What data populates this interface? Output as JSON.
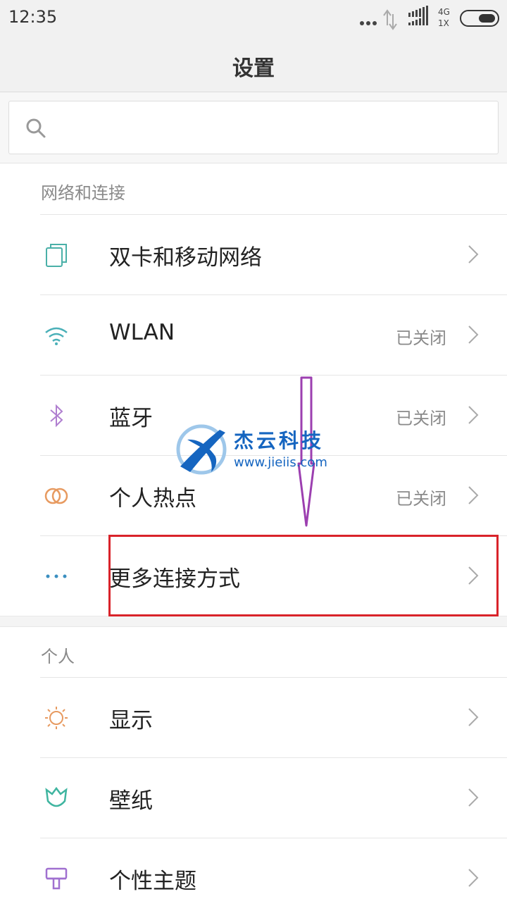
{
  "status_bar": {
    "time": "12:35",
    "net_top": "4G",
    "net_bottom": "1X"
  },
  "header": {
    "title": "设置"
  },
  "search": {
    "placeholder": ""
  },
  "sections": [
    {
      "title": "网络和连接",
      "items": [
        {
          "label": "双卡和移动网络",
          "status": "",
          "icon": "sim-cards-icon"
        },
        {
          "label": "WLAN",
          "status": "已关闭",
          "icon": "wifi-icon"
        },
        {
          "label": "蓝牙",
          "status": "已关闭",
          "icon": "bluetooth-icon"
        },
        {
          "label": "个人热点",
          "status": "已关闭",
          "icon": "hotspot-icon"
        },
        {
          "label": "更多连接方式",
          "status": "",
          "icon": "more-icon"
        }
      ]
    },
    {
      "title": "个人",
      "items": [
        {
          "label": "显示",
          "status": "",
          "icon": "brightness-icon"
        },
        {
          "label": "壁纸",
          "status": "",
          "icon": "wallpaper-icon"
        },
        {
          "label": "个性主题",
          "status": "",
          "icon": "theme-icon"
        }
      ]
    }
  ],
  "watermark": {
    "title": "杰云科技",
    "url": "www.jieiis.com"
  },
  "colors": {
    "highlight": "#d9232a",
    "arrow": "#9c3fb0",
    "wifi": "#4ab0b8",
    "bluetooth": "#b07fd0",
    "hotspot": "#e79a60",
    "brightness": "#e79a60",
    "wallpaper": "#3fb5a0",
    "theme": "#a070d0"
  }
}
